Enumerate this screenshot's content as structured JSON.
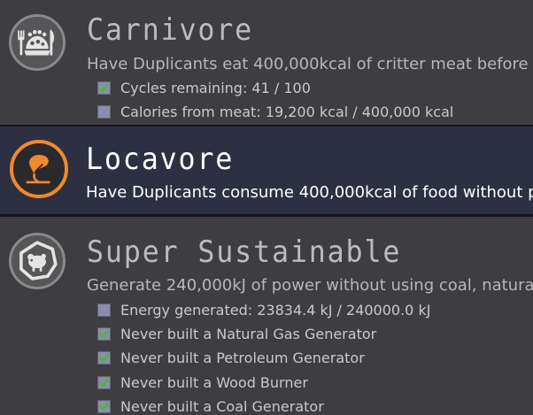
{
  "achievements": [
    {
      "title": "Carnivore",
      "description": "Have Duplicants eat 400,000kcal of critter meat before the",
      "icon": "carnivore-critter-fork-knife-icon",
      "requirements": [
        {
          "label": "Cycles remaining: 41 / 100",
          "checked": true
        },
        {
          "label": "Calories from meat: 19,200 kcal / 400,000 kcal",
          "checked": false
        }
      ]
    },
    {
      "title": "Locavore",
      "description": "Have Duplicants consume 400,000kcal of food without p",
      "icon": "locavore-sprout-icon",
      "selected": true,
      "requirements": []
    },
    {
      "title": "Super Sustainable",
      "description": "Generate 240,000kJ of power without using coal, natura",
      "icon": "super-sustainable-hamster-wheel-icon",
      "requirements": [
        {
          "label": "Energy generated: 23834.4 kJ / 240000.0 kJ",
          "checked": false
        },
        {
          "label": "Never built a Natural Gas Generator",
          "checked": true
        },
        {
          "label": "Never built a Petroleum Generator",
          "checked": true
        },
        {
          "label": "Never built a Wood Burner",
          "checked": true
        },
        {
          "label": "Never built a Coal Generator",
          "checked": true
        }
      ]
    }
  ],
  "colors": {
    "check_green": "#3fbf2a",
    "locavore_accent": "#ee8a2c"
  }
}
